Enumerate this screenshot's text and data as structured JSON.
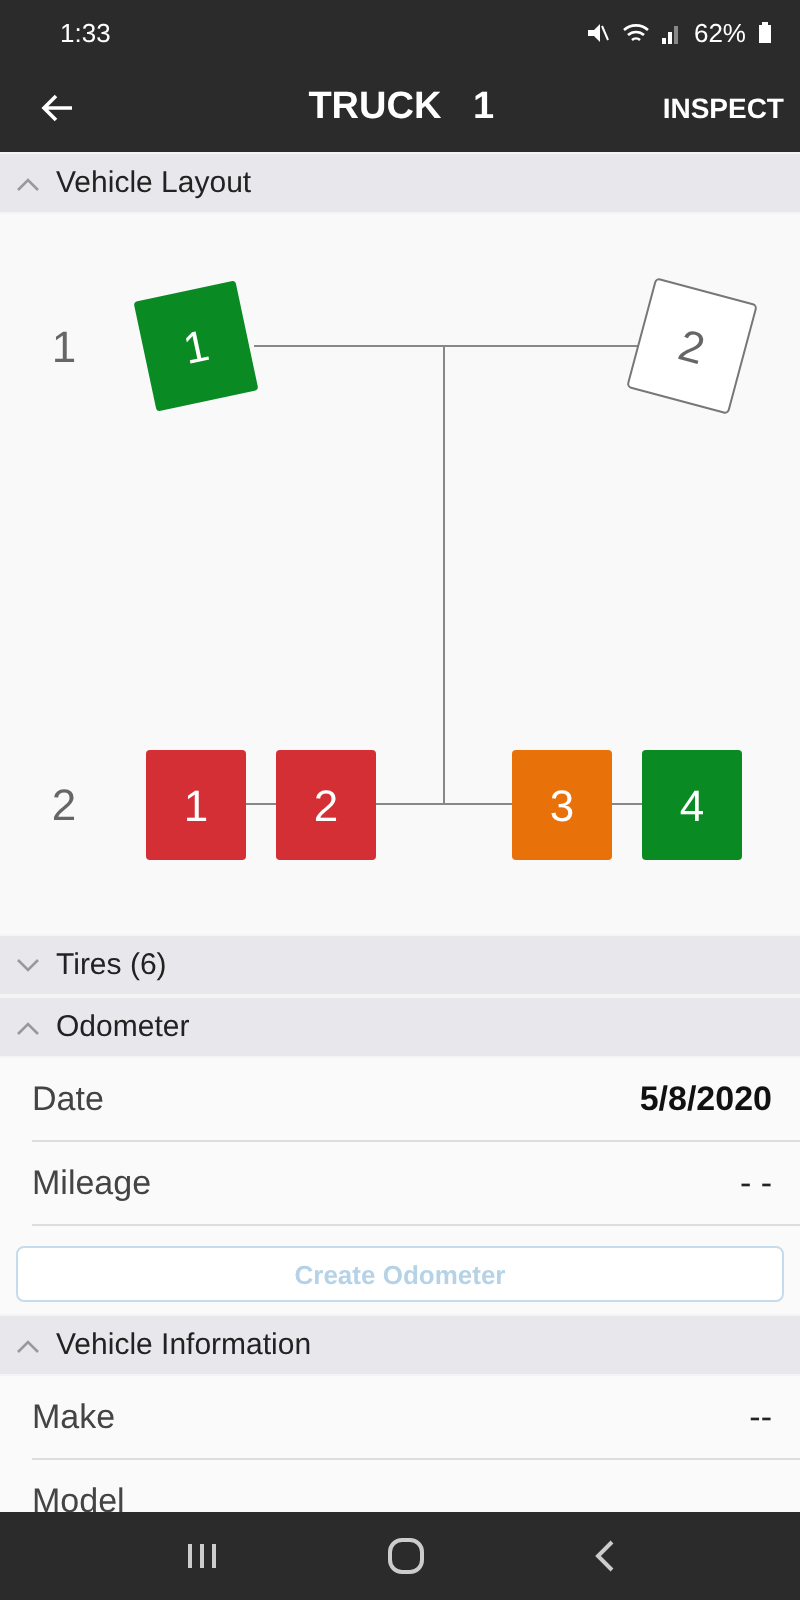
{
  "status_bar": {
    "time": "1:33",
    "battery": "62%"
  },
  "app_bar": {
    "title": "TRUCK   1",
    "action": "INSPECT"
  },
  "sections": [
    {
      "kind": "layout",
      "title": "Vehicle Layout",
      "expanded": true,
      "axles": [
        {
          "kind": "steer",
          "label": "1",
          "tires": [
            {
              "label": "1",
              "color": "#0a8a22"
            },
            {
              "label": "2",
              "color": "#ffffff"
            }
          ]
        },
        {
          "kind": "dual",
          "label": "2",
          "tires": [
            {
              "label": "1",
              "color": "#d32f35"
            },
            {
              "label": "2",
              "color": "#d32f35"
            },
            {
              "label": "3",
              "color": "#e8710a"
            },
            {
              "label": "4",
              "color": "#0a8a22"
            }
          ]
        }
      ]
    },
    {
      "kind": "header",
      "title": "Tires (6)",
      "expanded": false
    },
    {
      "kind": "fields",
      "title": "Odometer",
      "expanded": true,
      "rows": [
        {
          "label": "Date",
          "value": "5/8/2020",
          "bold": true
        },
        {
          "label": "Mileage",
          "value": "- -",
          "bold": false
        }
      ],
      "button": {
        "label": "Create Odometer",
        "disabled": true
      }
    },
    {
      "kind": "fields",
      "title": "Vehicle Information",
      "expanded": true,
      "rows": [
        {
          "label": "Make",
          "value": "--",
          "bold": false
        },
        {
          "label": "Model"
        }
      ]
    }
  ]
}
